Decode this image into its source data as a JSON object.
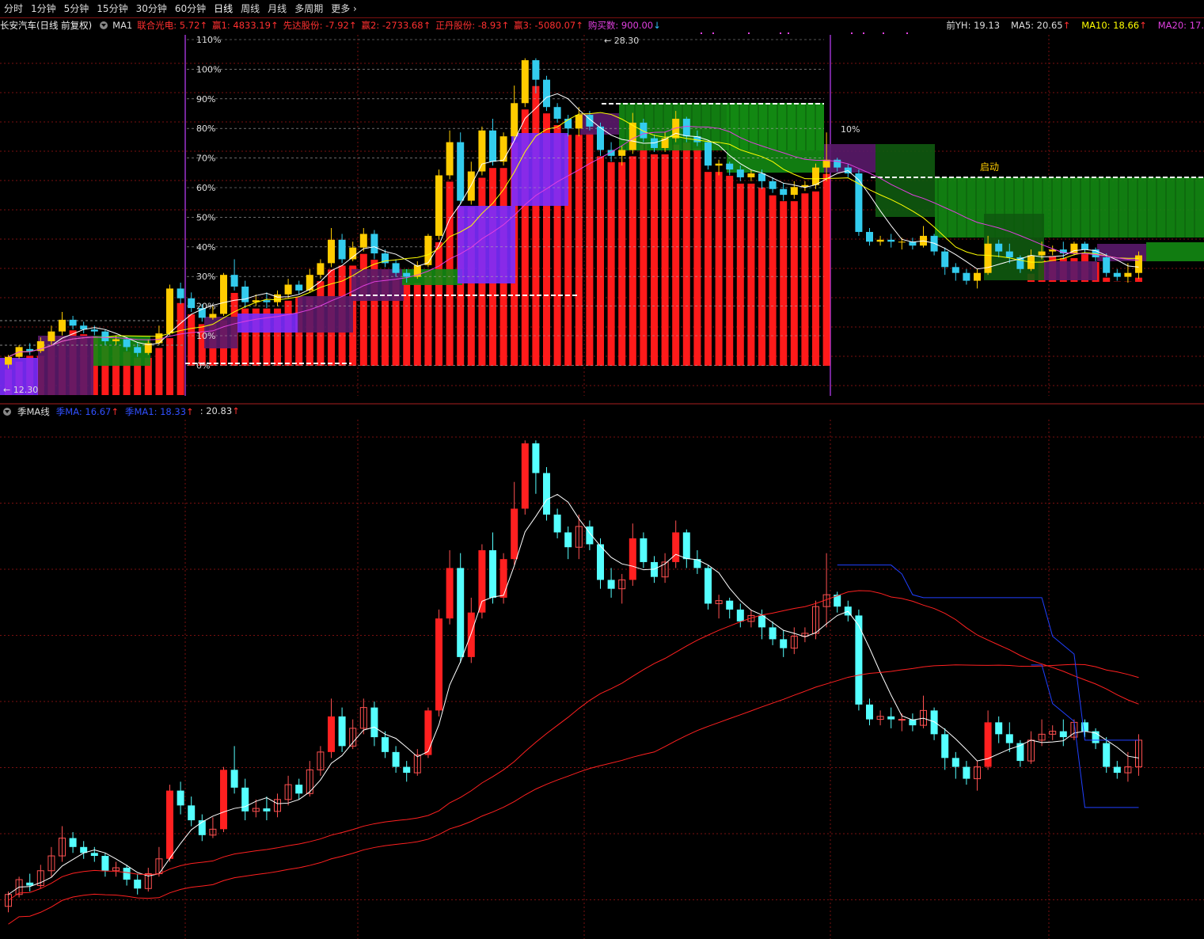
{
  "toolbar": {
    "tabs": [
      "分时",
      "1分钟",
      "5分钟",
      "15分钟",
      "30分钟",
      "60分钟",
      "日线",
      "周线",
      "月线",
      "多周期",
      "更多"
    ],
    "active": "日线"
  },
  "main_legend": {
    "stock": "长安汽车(日线 前复权)",
    "indicator": "MA1",
    "items": [
      {
        "label": "联合光电: 5.72",
        "color": "#ff3030",
        "arrow": "up"
      },
      {
        "label": "赢1: 4833.19",
        "color": "#ff3030",
        "arrow": "up"
      },
      {
        "label": "先达股份: -7.92",
        "color": "#ff3030",
        "arrow": "up"
      },
      {
        "label": "赢2: -2733.68",
        "color": "#ff3030",
        "arrow": "up"
      },
      {
        "label": "正丹股份: -8.93",
        "color": "#ff3030",
        "arrow": "up"
      },
      {
        "label": "赢3: -5080.07",
        "color": "#ff3030",
        "arrow": "up"
      },
      {
        "label": "购买数: 900.00",
        "color": "#e040e0",
        "arrow": "down"
      }
    ],
    "right_items": [
      {
        "label": "前YH: 19.13",
        "color": "#dddddd"
      },
      {
        "label": "MA5: 20.65",
        "color": "#dddddd",
        "arrow": "up"
      },
      {
        "label": "MA10: 18.66",
        "color": "#ffff00",
        "arrow": "up"
      },
      {
        "label": "MA20: 17.",
        "color": "#e040e0"
      }
    ]
  },
  "main_chart": {
    "pct_labels": [
      "110%",
      "100%",
      "90%",
      "80%",
      "70%",
      "60%",
      "50%",
      "40%",
      "30%",
      "20%",
      "10%",
      "0%"
    ],
    "high_label": "28.30",
    "low_label": "12.30",
    "right_pct_label": "10%",
    "start_label": "启动"
  },
  "sub_legend": {
    "name": "季MA线",
    "items": [
      {
        "label": "季MA: 16.67",
        "color": "#3050ff",
        "arrow": "up"
      },
      {
        "label": "季MA1: 18.33",
        "color": "#3050ff",
        "arrow": "up"
      },
      {
        "label": ": 20.83",
        "color": "#dddddd",
        "arrow": "up"
      }
    ]
  },
  "colors": {
    "up_main": "#ffcc00",
    "down_main": "#33ccee",
    "red_bar": "#ff1a1a",
    "green_zone": "#138a13",
    "purple_zone": "#7b2cff",
    "dark_purple": "#5a1a6a",
    "up_sub": "#ff2020",
    "down_sub": "#55ffff",
    "grid": "#7a1010",
    "ma_white": "#ffffff",
    "ma_yellow": "#ffff00",
    "ma_pink": "#e040e0"
  },
  "chart_data": {
    "type": "candlestick",
    "candles": [
      [
        12.6,
        13.0,
        12.4,
        13.1
      ],
      [
        13.0,
        13.5,
        12.9,
        13.6
      ],
      [
        13.4,
        13.3,
        13.1,
        13.7
      ],
      [
        13.3,
        13.8,
        13.2,
        14.0
      ],
      [
        13.8,
        14.3,
        13.6,
        14.6
      ],
      [
        14.3,
        14.9,
        14.1,
        15.3
      ],
      [
        14.9,
        14.6,
        14.4,
        15.1
      ],
      [
        14.6,
        14.4,
        14.2,
        14.8
      ],
      [
        14.4,
        14.3,
        14.1,
        14.6
      ],
      [
        14.3,
        13.8,
        13.6,
        14.4
      ],
      [
        13.8,
        13.9,
        13.6,
        14.1
      ],
      [
        13.9,
        13.5,
        13.3,
        14.0
      ],
      [
        13.5,
        13.2,
        13.0,
        13.7
      ],
      [
        13.2,
        13.7,
        13.1,
        13.9
      ],
      [
        13.7,
        14.2,
        13.6,
        14.6
      ],
      [
        14.2,
        16.5,
        14.1,
        16.7
      ],
      [
        16.5,
        16.0,
        15.7,
        16.8
      ],
      [
        16.0,
        15.5,
        15.3,
        16.3
      ],
      [
        15.5,
        15.0,
        14.8,
        15.7
      ],
      [
        15.0,
        15.2,
        14.9,
        15.6
      ],
      [
        15.2,
        17.2,
        15.1,
        17.3
      ],
      [
        17.2,
        16.6,
        16.4,
        18.0
      ],
      [
        16.6,
        15.8,
        15.5,
        16.9
      ],
      [
        15.8,
        15.9,
        15.6,
        16.2
      ],
      [
        15.9,
        15.8,
        15.5,
        16.3
      ],
      [
        15.8,
        16.2,
        15.6,
        16.4
      ],
      [
        16.2,
        16.7,
        16.0,
        17.0
      ],
      [
        16.7,
        16.4,
        16.2,
        16.9
      ],
      [
        16.4,
        17.2,
        16.3,
        17.5
      ],
      [
        17.2,
        17.8,
        17.0,
        18.0
      ],
      [
        17.8,
        19.0,
        17.6,
        19.6
      ],
      [
        19.0,
        18.0,
        17.8,
        19.3
      ],
      [
        18.0,
        18.6,
        17.9,
        18.9
      ],
      [
        18.6,
        19.3,
        18.4,
        19.6
      ],
      [
        19.3,
        18.3,
        18.0,
        19.5
      ],
      [
        18.3,
        17.8,
        17.6,
        18.5
      ],
      [
        17.8,
        17.3,
        17.1,
        18.0
      ],
      [
        17.3,
        17.1,
        16.8,
        17.5
      ],
      [
        17.1,
        17.7,
        17.0,
        17.9
      ],
      [
        17.7,
        19.2,
        17.6,
        19.3
      ],
      [
        19.2,
        22.3,
        19.0,
        22.6
      ],
      [
        22.3,
        24.0,
        22.1,
        24.6
      ],
      [
        24.0,
        21.0,
        20.8,
        24.5
      ],
      [
        21.0,
        22.5,
        20.8,
        23.0
      ],
      [
        22.5,
        24.6,
        22.3,
        24.8
      ],
      [
        24.6,
        23.0,
        22.8,
        25.2
      ],
      [
        23.0,
        24.3,
        22.8,
        24.5
      ],
      [
        24.3,
        26.0,
        24.1,
        26.9
      ],
      [
        26.0,
        28.2,
        25.8,
        28.3
      ],
      [
        28.2,
        27.2,
        26.5,
        28.3
      ],
      [
        27.2,
        25.8,
        25.6,
        27.4
      ],
      [
        25.8,
        25.2,
        25.0,
        26.0
      ],
      [
        25.2,
        24.7,
        24.3,
        25.4
      ],
      [
        24.7,
        25.4,
        24.3,
        25.8
      ],
      [
        25.4,
        24.8,
        24.6,
        25.6
      ],
      [
        24.8,
        23.6,
        23.3,
        25.0
      ],
      [
        23.6,
        23.3,
        23.0,
        24.0
      ],
      [
        23.3,
        23.6,
        22.8,
        23.8
      ],
      [
        23.6,
        25.0,
        23.4,
        25.5
      ],
      [
        25.0,
        24.2,
        24.0,
        25.2
      ],
      [
        24.2,
        23.7,
        23.5,
        24.4
      ],
      [
        23.7,
        24.2,
        23.5,
        24.5
      ],
      [
        24.2,
        25.2,
        24.0,
        25.6
      ],
      [
        25.2,
        24.3,
        24.0,
        25.3
      ],
      [
        24.3,
        24.0,
        23.8,
        24.6
      ],
      [
        24.0,
        22.8,
        22.6,
        24.1
      ],
      [
        22.8,
        22.9,
        22.3,
        23.1
      ],
      [
        22.9,
        22.6,
        22.3,
        23.0
      ],
      [
        22.6,
        22.2,
        22.0,
        22.8
      ],
      [
        22.2,
        22.4,
        22.0,
        22.6
      ],
      [
        22.4,
        22.0,
        21.6,
        22.6
      ],
      [
        22.0,
        21.6,
        21.4,
        22.2
      ],
      [
        21.6,
        21.3,
        21.0,
        21.9
      ],
      [
        21.3,
        21.7,
        21.1,
        22.0
      ],
      [
        21.7,
        21.8,
        21.5,
        22.0
      ],
      [
        21.8,
        22.7,
        21.6,
        22.9
      ],
      [
        22.7,
        23.1,
        22.0,
        24.5
      ],
      [
        23.1,
        22.7,
        22.5,
        23.2
      ],
      [
        22.7,
        22.4,
        22.2,
        22.9
      ],
      [
        22.4,
        19.4,
        19.2,
        22.6
      ],
      [
        19.4,
        18.9,
        18.7,
        19.6
      ],
      [
        18.9,
        19.0,
        18.7,
        19.2
      ],
      [
        19.0,
        18.9,
        18.6,
        19.3
      ],
      [
        18.9,
        18.9,
        18.5,
        19.1
      ],
      [
        18.9,
        18.7,
        18.5,
        19.1
      ],
      [
        18.7,
        19.2,
        18.6,
        19.7
      ],
      [
        19.2,
        18.4,
        18.2,
        19.3
      ],
      [
        18.4,
        17.6,
        17.2,
        18.6
      ],
      [
        17.6,
        17.3,
        16.9,
        17.8
      ],
      [
        17.3,
        16.9,
        16.7,
        17.5
      ],
      [
        16.9,
        17.3,
        16.5,
        17.5
      ],
      [
        17.3,
        18.8,
        17.2,
        19.2
      ],
      [
        18.8,
        18.4,
        18.1,
        19.0
      ],
      [
        18.4,
        18.1,
        17.8,
        18.8
      ],
      [
        18.1,
        17.5,
        17.3,
        18.2
      ],
      [
        17.5,
        18.2,
        17.4,
        18.5
      ],
      [
        18.2,
        18.4,
        18.0,
        18.9
      ],
      [
        18.4,
        18.5,
        18.2,
        18.7
      ],
      [
        18.5,
        18.3,
        18.0,
        18.9
      ],
      [
        18.3,
        18.8,
        18.2,
        18.9
      ],
      [
        18.8,
        18.5,
        18.3,
        18.9
      ],
      [
        18.5,
        18.1,
        17.9,
        18.6
      ],
      [
        18.1,
        17.3,
        17.1,
        18.3
      ],
      [
        17.3,
        17.1,
        16.9,
        17.5
      ],
      [
        17.1,
        17.3,
        16.8,
        17.8
      ],
      [
        17.3,
        18.2,
        17.0,
        18.4
      ]
    ],
    "sub_chart": "季MA线 with MA lines over same candles"
  }
}
